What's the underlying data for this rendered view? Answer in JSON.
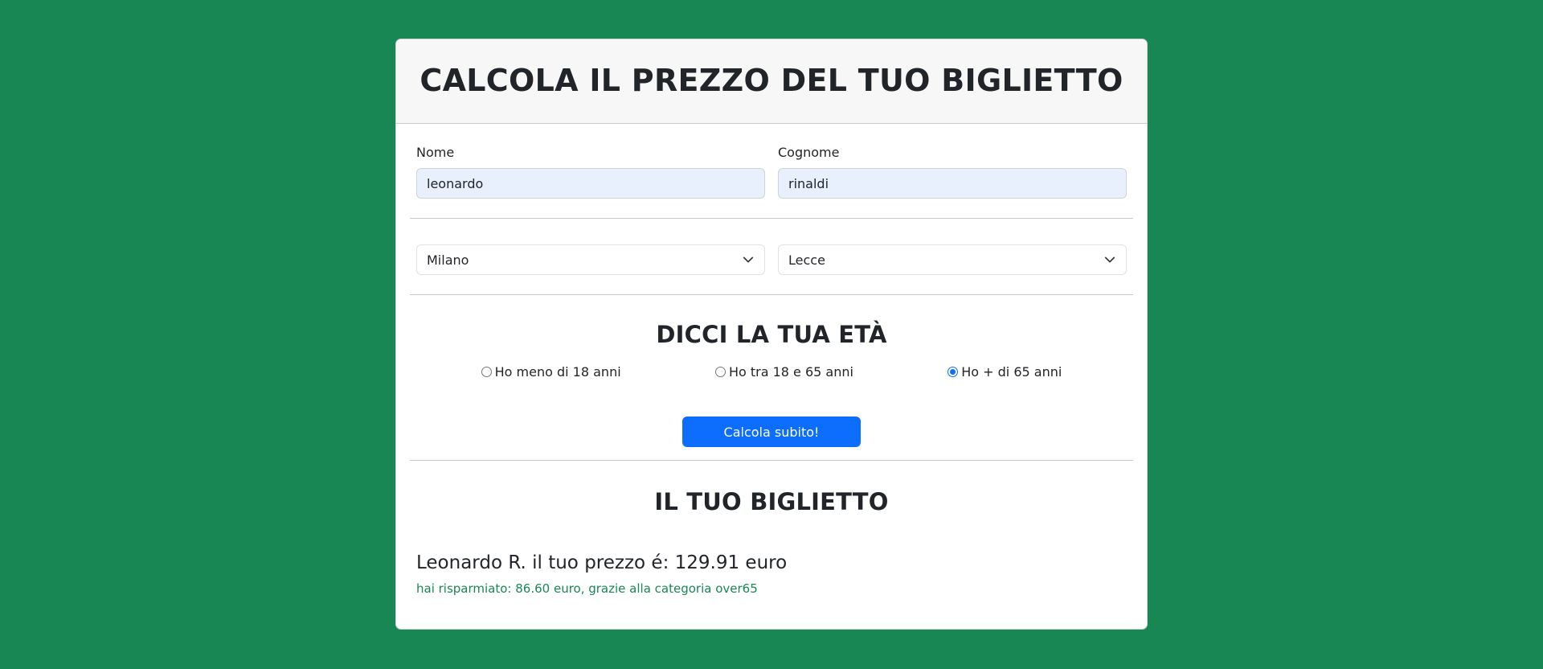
{
  "header": {
    "title": "CALCOLA IL PREZZO DEL TUO BIGLIETTO"
  },
  "form": {
    "first_name": {
      "label": "Nome",
      "value": "leonardo"
    },
    "last_name": {
      "label": "Cognome",
      "value": "rinaldi"
    },
    "departure": {
      "value": "Milano"
    },
    "destination": {
      "value": "Lecce"
    }
  },
  "age": {
    "title": "DICCI LA TUA ETÀ",
    "options": [
      {
        "label": "Ho meno di 18 anni",
        "checked": false
      },
      {
        "label": "Ho tra 18 e 65 anni",
        "checked": false
      },
      {
        "label": "Ho + di 65 anni",
        "checked": true
      }
    ]
  },
  "actions": {
    "calculate_label": "Calcola subito!"
  },
  "ticket": {
    "title": "IL TUO BIGLIETTO",
    "price_line": "Leonardo R. il tuo prezzo é: 129.91 euro",
    "savings_line": "hai risparmiato: 86.60 euro, grazie alla categoria over65"
  },
  "colors": {
    "background": "#198754",
    "primary": "#0d6efd",
    "success_text": "#198754",
    "autofill_input": "#e8f0fe"
  }
}
